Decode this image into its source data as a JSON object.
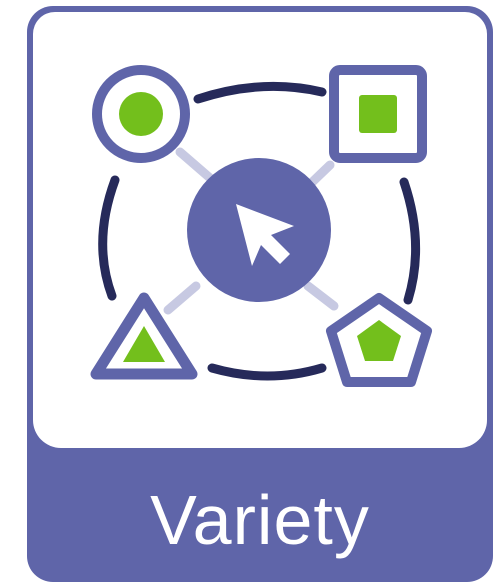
{
  "card": {
    "label": "Variety"
  },
  "colors": {
    "primary": "#5f65a9",
    "dark_ring": "#262a5a",
    "connector": "#c7c9e2",
    "accent_green": "#73bf1c",
    "background": "#ffffff"
  },
  "icons": {
    "center": "cursor-arrow-icon",
    "top_left": "circle-shape-icon",
    "top_right": "square-shape-icon",
    "bottom_left": "triangle-shape-icon",
    "bottom_right": "pentagon-shape-icon"
  }
}
